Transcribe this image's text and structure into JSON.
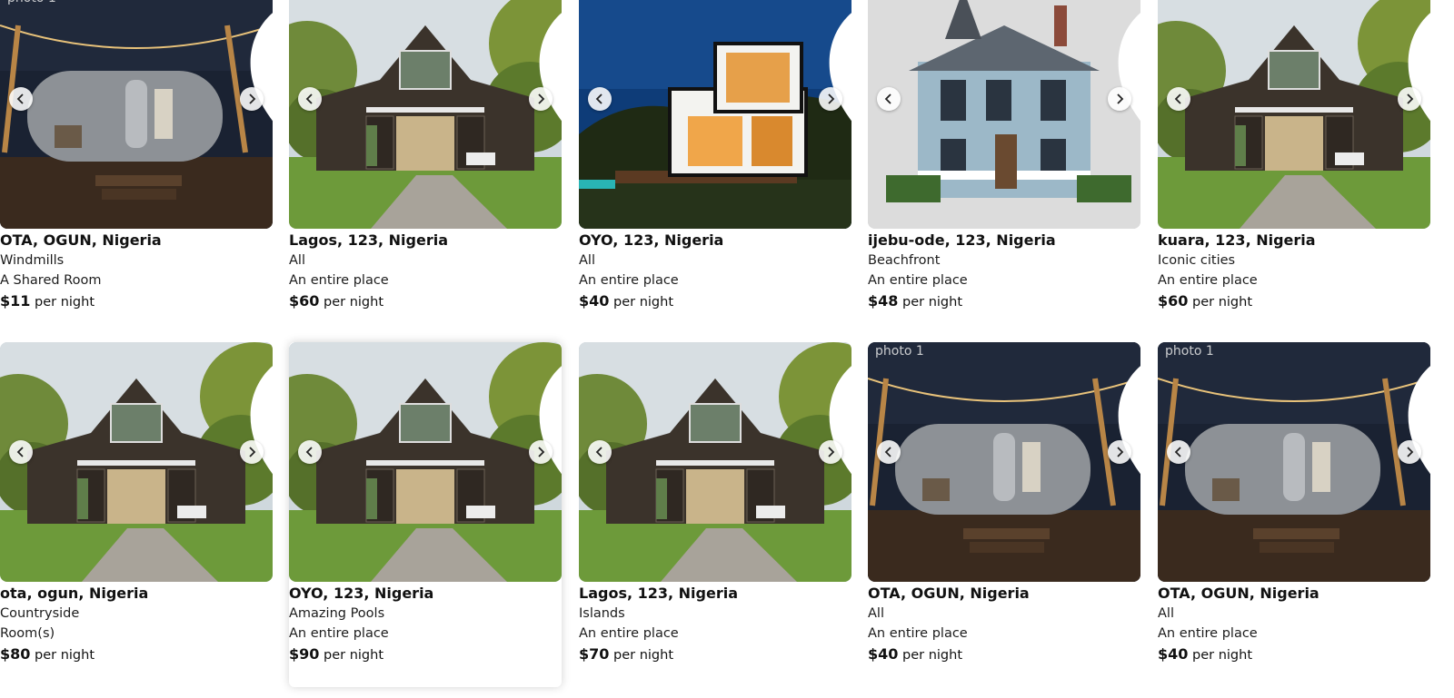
{
  "labels": {
    "per_night": "per night",
    "broken_image_alt": "photo 1"
  },
  "colors": {
    "heart": "#ffffff",
    "nav_bg": "#ffffff",
    "text": "#111111"
  },
  "icons": {
    "favorite": "heart-icon",
    "prev": "chevron-left-icon",
    "next": "chevron-right-icon"
  },
  "listings": [
    {
      "location": "OTA, OGUN, Nigeria",
      "category": "Windmills",
      "place_type": "A Shared Room",
      "price": "$11",
      "image": "airstream",
      "broken_alt": true
    },
    {
      "location": "Lagos, 123, Nigeria",
      "category": "All",
      "place_type": "An entire place",
      "price": "$60",
      "image": "barn"
    },
    {
      "location": "OYO, 123, Nigeria",
      "category": "All",
      "place_type": "An entire place",
      "price": "$40",
      "image": "modern"
    },
    {
      "location": "ijebu-ode, 123, Nigeria",
      "category": "Beachfront",
      "place_type": "An entire place",
      "price": "$48",
      "image": "victorian"
    },
    {
      "location": "kuara, 123, Nigeria",
      "category": "Iconic cities",
      "place_type": "An entire place",
      "price": "$60",
      "image": "barn"
    },
    {
      "location": "ota, ogun, Nigeria",
      "category": "Countryside",
      "place_type": "Room(s)",
      "price": "$80",
      "image": "barn"
    },
    {
      "location": "OYO, 123, Nigeria",
      "category": "Amazing Pools",
      "place_type": "An entire place",
      "price": "$90",
      "image": "barn"
    },
    {
      "location": "Lagos, 123, Nigeria",
      "category": "Islands",
      "place_type": "An entire place",
      "price": "$70",
      "image": "barn"
    },
    {
      "location": "OTA, OGUN, Nigeria",
      "category": "All",
      "place_type": "An entire place",
      "price": "$40",
      "image": "airstream",
      "broken_alt": true
    },
    {
      "location": "OTA, OGUN, Nigeria",
      "category": "All",
      "place_type": "An entire place",
      "price": "$40",
      "image": "airstream",
      "broken_alt": true
    }
  ]
}
